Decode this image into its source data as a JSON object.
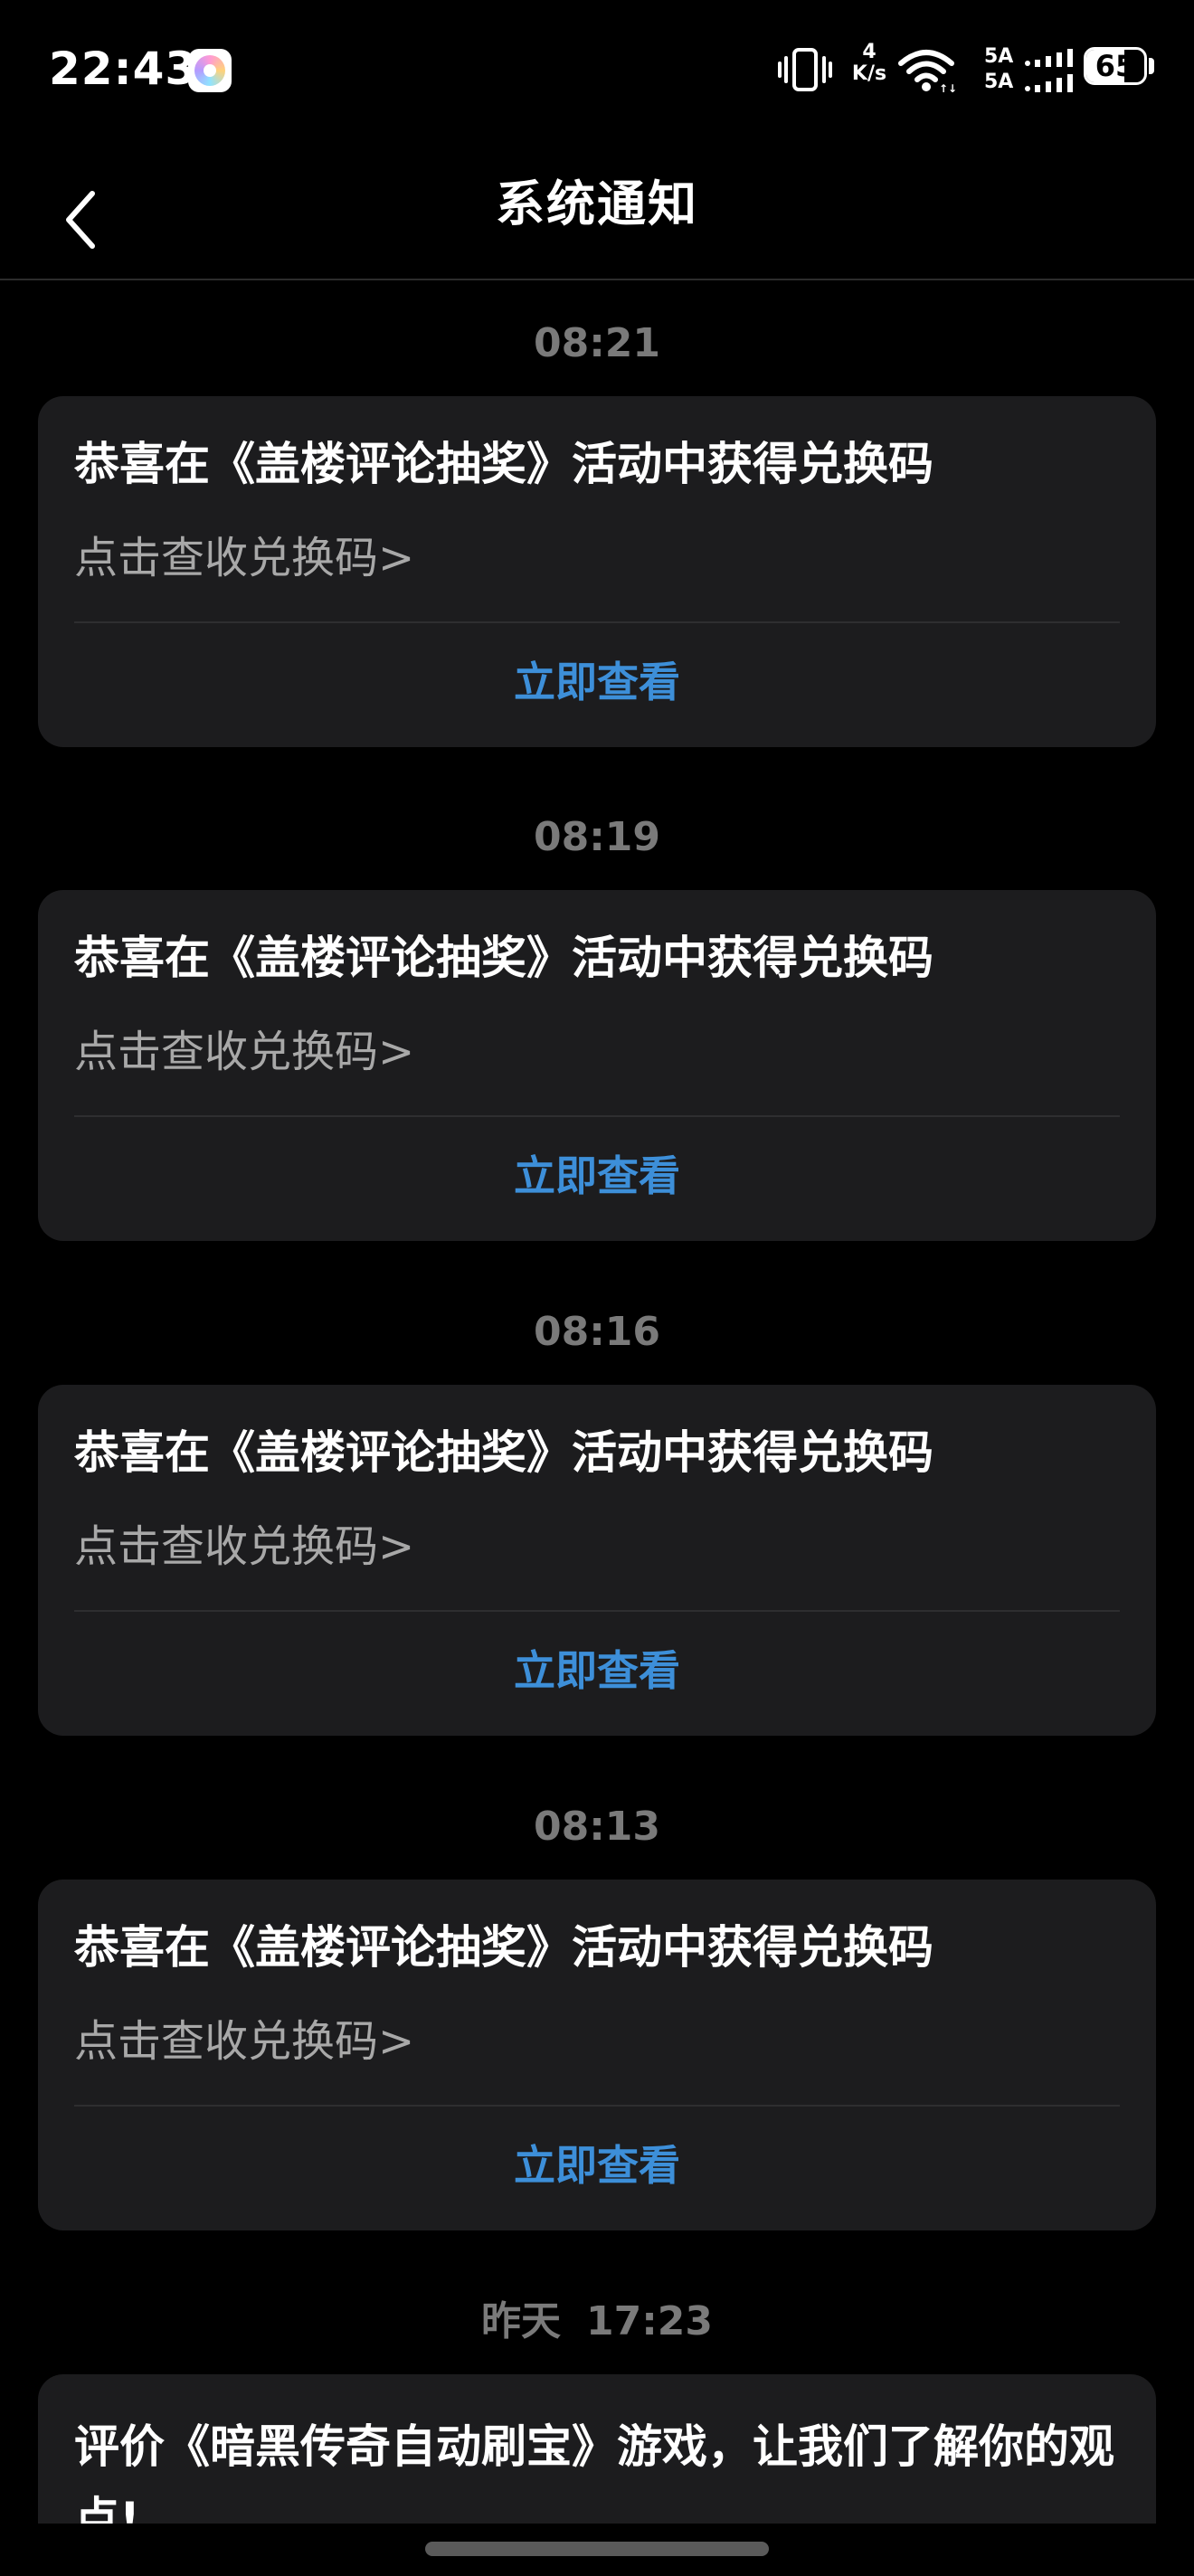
{
  "status_bar": {
    "time": "22:43",
    "net_speed_value": "4",
    "net_speed_unit": "K/s",
    "sim1_label": "5A",
    "sim2_label": "5A",
    "battery_percent": "65",
    "battery_level": 0.65
  },
  "nav": {
    "title": "系统通知",
    "back_icon": "chevron-left-icon"
  },
  "messages": [
    {
      "time": "08:21",
      "title": "恭喜在《盖楼评论抽奖》活动中获得兑换码",
      "subtitle": "点击查收兑换码>",
      "action": "立即查看"
    },
    {
      "time": "08:19",
      "title": "恭喜在《盖楼评论抽奖》活动中获得兑换码",
      "subtitle": "点击查收兑换码>",
      "action": "立即查看"
    },
    {
      "time": "08:16",
      "title": "恭喜在《盖楼评论抽奖》活动中获得兑换码",
      "subtitle": "点击查收兑换码>",
      "action": "立即查看"
    },
    {
      "time": "08:13",
      "title": "恭喜在《盖楼评论抽奖》活动中获得兑换码",
      "subtitle": "点击查收兑换码>",
      "action": "立即查看"
    },
    {
      "time_day": "昨天",
      "time": "17:23",
      "title": "评价《暗黑传奇自动刷宝》游戏，让我们了解你的观点!"
    }
  ],
  "colors": {
    "background": "#000000",
    "card": "#1c1c1e",
    "action_blue": "#3d8fd9",
    "time_gray": "#7a7a7a",
    "subtitle_gray": "#a8a8a8"
  }
}
